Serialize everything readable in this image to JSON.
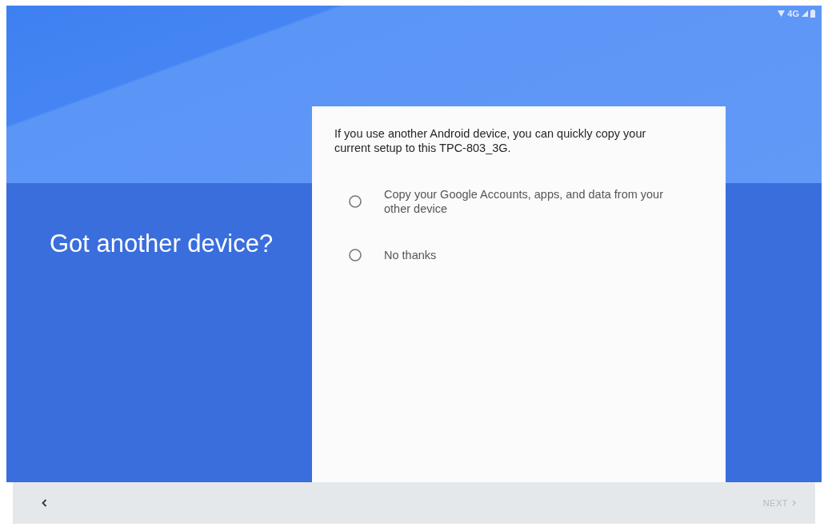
{
  "status_bar": {
    "network": "4G"
  },
  "header": {
    "title": "Got another device?"
  },
  "card": {
    "intro": "If you use another Android device, you can quickly copy your current setup to this TPC-803_3G.",
    "options": [
      {
        "label": "Copy your Google Accounts, apps, and data from your other device",
        "selected": false
      },
      {
        "label": "No thanks",
        "selected": false
      }
    ]
  },
  "nav_bar": {
    "next": {
      "label": "NEXT",
      "disabled": true
    }
  }
}
